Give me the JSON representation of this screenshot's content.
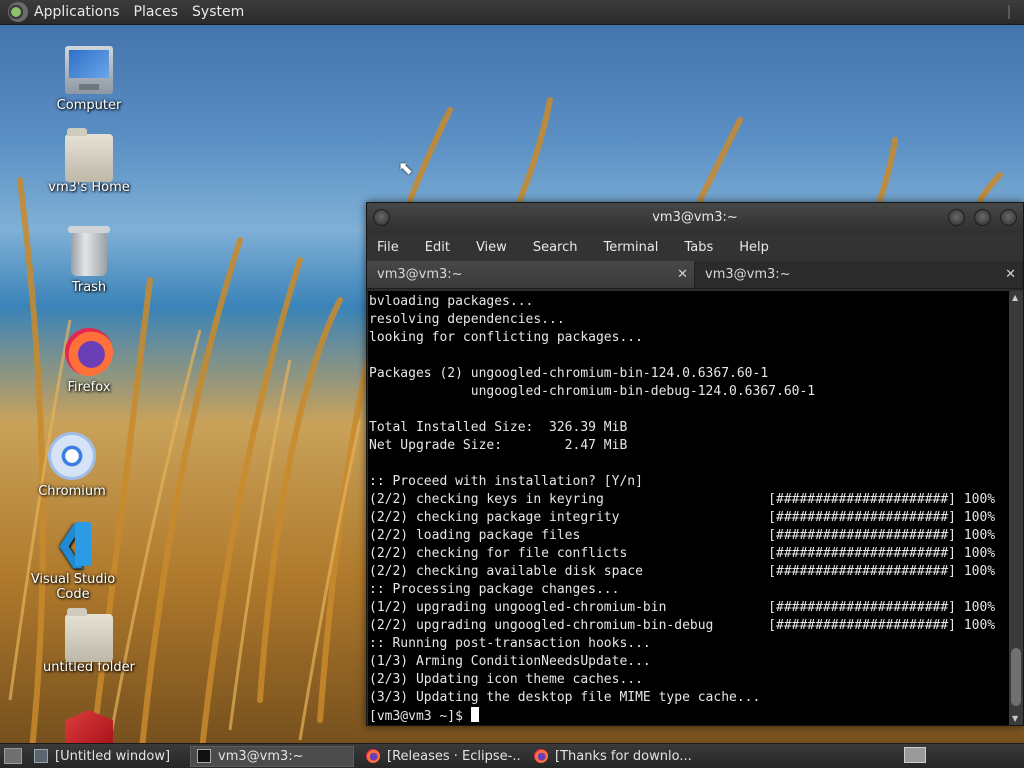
{
  "top_panel": {
    "menus": [
      "Applications",
      "Places",
      "System"
    ]
  },
  "desktop_icons": [
    {
      "label": "Computer",
      "icon": "computer-icon"
    },
    {
      "label": "vm3's Home",
      "icon": "home-folder-icon"
    },
    {
      "label": "Trash",
      "icon": "trash-icon"
    },
    {
      "label": "Firefox",
      "icon": "firefox-icon"
    },
    {
      "label": "Chromium",
      "icon": "chromium-icon"
    },
    {
      "label": "Visual Studio Code",
      "icon": "vscode-icon"
    },
    {
      "label": "untitled folder",
      "icon": "folder-icon"
    }
  ],
  "terminal": {
    "title": "vm3@vm3:~",
    "menu": [
      "File",
      "Edit",
      "View",
      "Search",
      "Terminal",
      "Tabs",
      "Help"
    ],
    "tabs": [
      {
        "label": "vm3@vm3:~",
        "close": "✕"
      },
      {
        "label": "vm3@vm3:~",
        "close": "✕"
      }
    ],
    "lines": [
      "bvloading packages...",
      "resolving dependencies...",
      "looking for conflicting packages...",
      "",
      "Packages (2) ungoogled-chromium-bin-124.0.6367.60-1",
      "             ungoogled-chromium-bin-debug-124.0.6367.60-1",
      "",
      "Total Installed Size:  326.39 MiB",
      "Net Upgrade Size:        2.47 MiB",
      "",
      ":: Proceed with installation? [Y/n]",
      "(2/2) checking keys in keyring                     [######################] 100%",
      "(2/2) checking package integrity                   [######################] 100%",
      "(2/2) loading package files                        [######################] 100%",
      "(2/2) checking for file conflicts                  [######################] 100%",
      "(2/2) checking available disk space                [######################] 100%",
      ":: Processing package changes...",
      "(1/2) upgrading ungoogled-chromium-bin             [######################] 100%",
      "(2/2) upgrading ungoogled-chromium-bin-debug       [######################] 100%",
      ":: Running post-transaction hooks...",
      "(1/3) Arming ConditionNeedsUpdate...",
      "(2/3) Updating icon theme caches...",
      "(3/3) Updating the desktop file MIME type cache..."
    ],
    "prompt": "[vm3@vm3 ~]$ "
  },
  "taskbar": {
    "tasks": [
      {
        "label": "[Untitled window]",
        "icon": "window-icon"
      },
      {
        "label": "vm3@vm3:~",
        "icon": "terminal-icon"
      },
      {
        "label": "[Releases · Eclipse-...",
        "icon": "firefox-icon"
      },
      {
        "label": "[Thanks for downlo...",
        "icon": "firefox-icon"
      }
    ]
  }
}
